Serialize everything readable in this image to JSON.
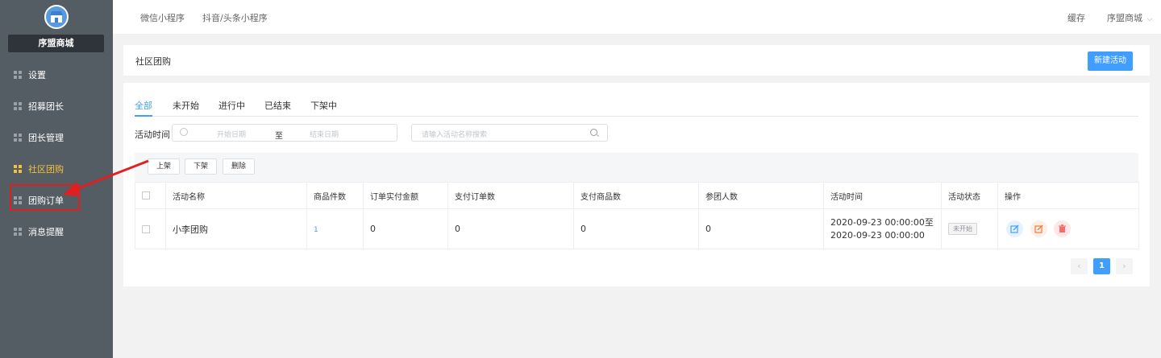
{
  "sidebar": {
    "shop_name": "序盟商城",
    "logo_icon": "store-icon",
    "items": [
      {
        "label": "设置",
        "active": false
      },
      {
        "label": "招募团长",
        "active": false
      },
      {
        "label": "团长管理",
        "active": false
      },
      {
        "label": "社区团购",
        "active": true
      },
      {
        "label": "团购订单",
        "active": false
      },
      {
        "label": "消息提醒",
        "active": false
      }
    ]
  },
  "topbar": {
    "tabs": [
      "微信小程序",
      "抖音/头条小程序"
    ],
    "cache_label": "缓存",
    "shop_dropdown": "序盟商城"
  },
  "header": {
    "title": "社区团购",
    "new_button": "新建活动"
  },
  "filter_tabs": [
    "全部",
    "未开始",
    "进行中",
    "已结束",
    "下架中"
  ],
  "filters": {
    "time_label": "活动时间",
    "start_placeholder": "开始日期",
    "range_separator": "至",
    "end_placeholder": "结束日期",
    "search_placeholder": "请输入活动名称搜索"
  },
  "bulk_actions": [
    "上架",
    "下架",
    "删除"
  ],
  "table": {
    "columns": [
      "活动名称",
      "商品件数",
      "订单实付金额",
      "支付订单数",
      "支付商品数",
      "参团人数",
      "活动时间",
      "活动状态",
      "操作"
    ],
    "rows": [
      {
        "name": "小李团购",
        "items": "1",
        "amount": "0",
        "orders": "0",
        "goods": "0",
        "members": "0",
        "time_start": "2020-09-23 00:00:00至",
        "time_end": "2020-09-23 00:00:00",
        "status": "未开始"
      }
    ]
  },
  "pagination": {
    "prev": "‹",
    "current": "1",
    "next": "›"
  },
  "colors": {
    "accent": "#409eff",
    "sidebar_bg": "#545c64",
    "active_menu": "#f6c13a",
    "annotation": "#e02020"
  }
}
